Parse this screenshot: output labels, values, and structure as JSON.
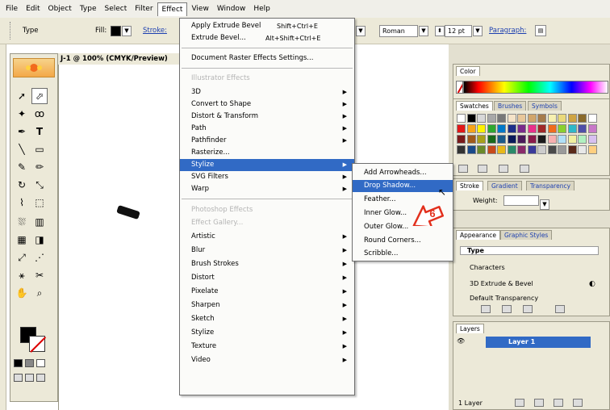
{
  "menubar": {
    "items": [
      "File",
      "Edit",
      "Object",
      "Type",
      "Select",
      "Filter",
      "Effect",
      "View",
      "Window",
      "Help"
    ],
    "active": "Effect"
  },
  "control_bar": {
    "type_label": "Type",
    "fill_label": "Fill:",
    "stroke_label": "Stroke:",
    "font_style": "Roman",
    "font_size": "12 pt",
    "paragraph_label": "Paragraph:"
  },
  "document": {
    "title": "J-1 @ 100% (CMYK/Preview)"
  },
  "effect_menu": {
    "apply_label": "Apply Extrude Bevel",
    "apply_shortcut": "Shift+Ctrl+E",
    "extrude_label": "Extrude Bevel...",
    "extrude_shortcut": "Alt+Shift+Ctrl+E",
    "raster_settings": "Document Raster Effects Settings...",
    "illustrator_header": "Illustrator Effects",
    "illustrator_items": [
      "3D",
      "Convert to Shape",
      "Distort & Transform",
      "Path",
      "Pathfinder",
      "Rasterize...",
      "Stylize",
      "SVG Filters",
      "Warp"
    ],
    "photoshop_header": "Photoshop Effects",
    "effect_gallery": "Effect Gallery...",
    "photoshop_items": [
      "Artistic",
      "Blur",
      "Brush Strokes",
      "Distort",
      "Pixelate",
      "Sharpen",
      "Sketch",
      "Stylize",
      "Texture",
      "Video"
    ],
    "highlighted": "Stylize"
  },
  "stylize_submenu": {
    "items": [
      "Add Arrowheads...",
      "Drop Shadow...",
      "Feather...",
      "Inner Glow...",
      "Outer Glow...",
      "Round Corners...",
      "Scribble..."
    ],
    "highlighted": "Drop Shadow..."
  },
  "annotation": {
    "step_number": "6",
    "color": "#e2301d"
  },
  "panels": {
    "color_tab": "Color",
    "swatches_tabs": [
      "Swatches",
      "Brushes",
      "Symbols"
    ],
    "stroke_tabs": [
      "Stroke",
      "Gradient",
      "Transparency"
    ],
    "weight_label": "Weight:",
    "appearance_tabs": [
      "Appearance",
      "Graphic Styles"
    ],
    "appearance_type": "Type",
    "appearance_rows": [
      "Characters",
      "3D Extrude & Bevel",
      "Default Transparency"
    ],
    "layers_tab": "Layers",
    "layer_name": "Layer 1",
    "layer_count": "1 Layer"
  },
  "colors": {
    "menu_highlight": "#316ac5",
    "link_blue": "#1c3fb0"
  }
}
